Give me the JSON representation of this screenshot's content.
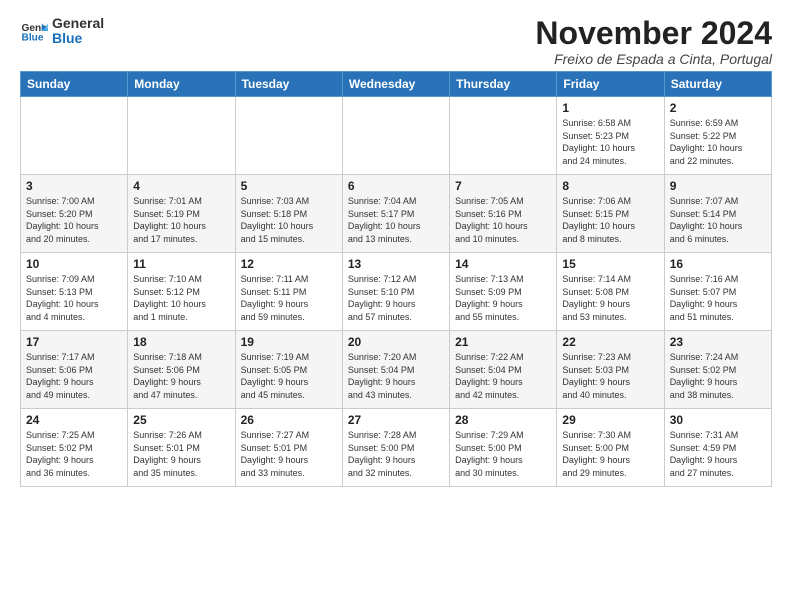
{
  "logo": {
    "text_general": "General",
    "text_blue": "Blue"
  },
  "header": {
    "month": "November 2024",
    "location": "Freixo de Espada a Cinta, Portugal"
  },
  "weekdays": [
    "Sunday",
    "Monday",
    "Tuesday",
    "Wednesday",
    "Thursday",
    "Friday",
    "Saturday"
  ],
  "weeks": [
    [
      {
        "day": "",
        "info": ""
      },
      {
        "day": "",
        "info": ""
      },
      {
        "day": "",
        "info": ""
      },
      {
        "day": "",
        "info": ""
      },
      {
        "day": "",
        "info": ""
      },
      {
        "day": "1",
        "info": "Sunrise: 6:58 AM\nSunset: 5:23 PM\nDaylight: 10 hours\nand 24 minutes."
      },
      {
        "day": "2",
        "info": "Sunrise: 6:59 AM\nSunset: 5:22 PM\nDaylight: 10 hours\nand 22 minutes."
      }
    ],
    [
      {
        "day": "3",
        "info": "Sunrise: 7:00 AM\nSunset: 5:20 PM\nDaylight: 10 hours\nand 20 minutes."
      },
      {
        "day": "4",
        "info": "Sunrise: 7:01 AM\nSunset: 5:19 PM\nDaylight: 10 hours\nand 17 minutes."
      },
      {
        "day": "5",
        "info": "Sunrise: 7:03 AM\nSunset: 5:18 PM\nDaylight: 10 hours\nand 15 minutes."
      },
      {
        "day": "6",
        "info": "Sunrise: 7:04 AM\nSunset: 5:17 PM\nDaylight: 10 hours\nand 13 minutes."
      },
      {
        "day": "7",
        "info": "Sunrise: 7:05 AM\nSunset: 5:16 PM\nDaylight: 10 hours\nand 10 minutes."
      },
      {
        "day": "8",
        "info": "Sunrise: 7:06 AM\nSunset: 5:15 PM\nDaylight: 10 hours\nand 8 minutes."
      },
      {
        "day": "9",
        "info": "Sunrise: 7:07 AM\nSunset: 5:14 PM\nDaylight: 10 hours\nand 6 minutes."
      }
    ],
    [
      {
        "day": "10",
        "info": "Sunrise: 7:09 AM\nSunset: 5:13 PM\nDaylight: 10 hours\nand 4 minutes."
      },
      {
        "day": "11",
        "info": "Sunrise: 7:10 AM\nSunset: 5:12 PM\nDaylight: 10 hours\nand 1 minute."
      },
      {
        "day": "12",
        "info": "Sunrise: 7:11 AM\nSunset: 5:11 PM\nDaylight: 9 hours\nand 59 minutes."
      },
      {
        "day": "13",
        "info": "Sunrise: 7:12 AM\nSunset: 5:10 PM\nDaylight: 9 hours\nand 57 minutes."
      },
      {
        "day": "14",
        "info": "Sunrise: 7:13 AM\nSunset: 5:09 PM\nDaylight: 9 hours\nand 55 minutes."
      },
      {
        "day": "15",
        "info": "Sunrise: 7:14 AM\nSunset: 5:08 PM\nDaylight: 9 hours\nand 53 minutes."
      },
      {
        "day": "16",
        "info": "Sunrise: 7:16 AM\nSunset: 5:07 PM\nDaylight: 9 hours\nand 51 minutes."
      }
    ],
    [
      {
        "day": "17",
        "info": "Sunrise: 7:17 AM\nSunset: 5:06 PM\nDaylight: 9 hours\nand 49 minutes."
      },
      {
        "day": "18",
        "info": "Sunrise: 7:18 AM\nSunset: 5:06 PM\nDaylight: 9 hours\nand 47 minutes."
      },
      {
        "day": "19",
        "info": "Sunrise: 7:19 AM\nSunset: 5:05 PM\nDaylight: 9 hours\nand 45 minutes."
      },
      {
        "day": "20",
        "info": "Sunrise: 7:20 AM\nSunset: 5:04 PM\nDaylight: 9 hours\nand 43 minutes."
      },
      {
        "day": "21",
        "info": "Sunrise: 7:22 AM\nSunset: 5:04 PM\nDaylight: 9 hours\nand 42 minutes."
      },
      {
        "day": "22",
        "info": "Sunrise: 7:23 AM\nSunset: 5:03 PM\nDaylight: 9 hours\nand 40 minutes."
      },
      {
        "day": "23",
        "info": "Sunrise: 7:24 AM\nSunset: 5:02 PM\nDaylight: 9 hours\nand 38 minutes."
      }
    ],
    [
      {
        "day": "24",
        "info": "Sunrise: 7:25 AM\nSunset: 5:02 PM\nDaylight: 9 hours\nand 36 minutes."
      },
      {
        "day": "25",
        "info": "Sunrise: 7:26 AM\nSunset: 5:01 PM\nDaylight: 9 hours\nand 35 minutes."
      },
      {
        "day": "26",
        "info": "Sunrise: 7:27 AM\nSunset: 5:01 PM\nDaylight: 9 hours\nand 33 minutes."
      },
      {
        "day": "27",
        "info": "Sunrise: 7:28 AM\nSunset: 5:00 PM\nDaylight: 9 hours\nand 32 minutes."
      },
      {
        "day": "28",
        "info": "Sunrise: 7:29 AM\nSunset: 5:00 PM\nDaylight: 9 hours\nand 30 minutes."
      },
      {
        "day": "29",
        "info": "Sunrise: 7:30 AM\nSunset: 5:00 PM\nDaylight: 9 hours\nand 29 minutes."
      },
      {
        "day": "30",
        "info": "Sunrise: 7:31 AM\nSunset: 4:59 PM\nDaylight: 9 hours\nand 27 minutes."
      }
    ]
  ]
}
